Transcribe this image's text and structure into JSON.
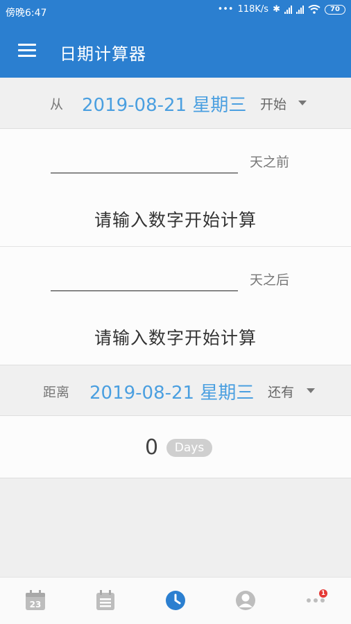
{
  "status_bar": {
    "time": "傍晚6:47",
    "network_speed": "118K/s",
    "battery": "70",
    "icons": [
      "bluetooth-icon",
      "signal-icon",
      "hd-signal-icon",
      "wifi-icon",
      "battery-icon"
    ]
  },
  "app_bar": {
    "title": "日期计算器",
    "menu_icon": "hamburger-menu-icon"
  },
  "from_row": {
    "label": "从",
    "date": "2019-08-21 星期三",
    "mode": "开始"
  },
  "before_card": {
    "input_value": "",
    "suffix": "天之前",
    "hint": "请输入数字开始计算"
  },
  "after_card": {
    "input_value": "",
    "suffix": "天之后",
    "hint": "请输入数字开始计算"
  },
  "distance_row": {
    "label": "距离",
    "date": "2019-08-21 星期三",
    "mode": "还有"
  },
  "result": {
    "count": "0",
    "unit": "Days"
  },
  "bottom_nav": {
    "items": [
      {
        "icon": "calendar-date-icon",
        "label": "23"
      },
      {
        "icon": "calendar-list-icon"
      },
      {
        "icon": "clock-icon",
        "active": true
      },
      {
        "icon": "user-avatar-icon"
      },
      {
        "icon": "more-dots-icon",
        "badge": "1"
      }
    ]
  },
  "colors": {
    "primary": "#2b7fd0",
    "date_text": "#4a9fe0",
    "badge_red": "#e53935"
  }
}
